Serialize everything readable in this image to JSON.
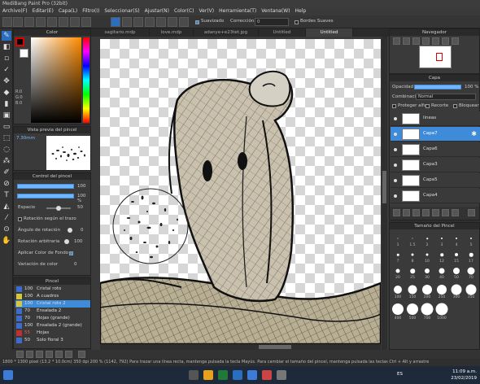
{
  "app": {
    "title": "MediBang Paint Pro (32bit)"
  },
  "menu": [
    "Archivo(F)",
    "Editar(E)",
    "Capa(L)",
    "Filtro(I)",
    "Seleccionar(S)",
    "Ajustar(N)",
    "Color(C)",
    "Ver(V)",
    "Herramienta(T)",
    "Ventana(W)",
    "Help"
  ],
  "tool_options": {
    "antialias_label": "Suavizado",
    "correction_label": "Corrección",
    "correction_value": "0",
    "edge_label": "Bordes Suaves"
  },
  "tabs": [
    "sagitario.mdp",
    "love.mdp",
    "adanye+e23tet.jpg",
    "Untitled",
    "Untitled"
  ],
  "color_panel": {
    "title": "Color",
    "r": "R:0",
    "g": "G:0",
    "b": "B:0"
  },
  "preview_panel": {
    "title": "Vista previa del pincel",
    "size": "7.30mm"
  },
  "brush_control": {
    "title": "Control del pincel",
    "size_value": "100",
    "opacity_value": "100 %",
    "spacing_label": "Espacio",
    "spacing_value": "50",
    "rotation_follow_label": "Rotación según el trazo",
    "rotation_angle_label": "Ángulo de rotación",
    "rotation_angle_value": "0",
    "rotation_random_label": "Rotación arbitraria",
    "rotation_random_value": "100",
    "apply_bg_label": "Aplicar Color de Fondo",
    "color_variation_label": "Variación de color",
    "color_variation_value": "0"
  },
  "brush_list": {
    "title": "Pincel",
    "items": [
      {
        "num": "100",
        "name": "Cristal roto",
        "color": "#3d6ccf"
      },
      {
        "num": "100",
        "name": "A cuadros",
        "color": "#d6c63a"
      },
      {
        "num": "100",
        "name": "Cristal roto 2",
        "color": "#d6c63a"
      },
      {
        "num": "70",
        "name": "Ensalada 2",
        "color": "#3d6ccf"
      },
      {
        "num": "70",
        "name": "Hojas (grande)",
        "color": "#3d6ccf"
      },
      {
        "num": "100",
        "name": "Ensalada 2 (grande)",
        "color": "#3d6ccf"
      },
      {
        "num": "55",
        "name": "Hojas",
        "color": "#c03030"
      },
      {
        "num": "50",
        "name": "Solo floral 3",
        "color": "#3d6ccf"
      }
    ],
    "selected_index": 2
  },
  "navigator": {
    "title": "Navegador"
  },
  "layers": {
    "title": "Capa",
    "opacity_label": "Opacidad",
    "opacity_value": "100 %",
    "blend_label": "Combinación",
    "blend_value": "Normal",
    "protect_alpha": "Proteger alfa",
    "clip": "Recorte",
    "lock": "Bloquear",
    "items": [
      "lineas",
      "Capa7",
      "Capa6",
      "Capa3",
      "Capa5",
      "Capa4"
    ],
    "selected_index": 1
  },
  "brush_size": {
    "title": "Tamaño del Pincel",
    "sizes": [
      "1",
      "1.5",
      "2",
      "3",
      "4",
      "5",
      "7",
      "8",
      "10",
      "12",
      "15",
      "17",
      "20",
      "25",
      "30",
      "40",
      "50",
      "70",
      "100",
      "150",
      "200",
      "250",
      "300",
      "350",
      "400",
      "500",
      "700",
      "1000"
    ]
  },
  "status": {
    "text": "1800 * 1300 pixel   (13.2 * 10.0cm)   350 dpi   200 %   (1142, 792)   Para trazar una línea recta, mantenga pulsada la tecla Mayús. Para cambiar el tamaño del pincel, mantenga pulsada las teclas Ctrl + Alt y arrastre"
  },
  "taskbar": {
    "lang": "ES",
    "time": "11:09 a.m.",
    "date": "23/02/2019"
  },
  "colors": {
    "accent": "#3d8bd9",
    "primary_swatch": "#000000",
    "secondary_swatch": "#ffffff"
  }
}
